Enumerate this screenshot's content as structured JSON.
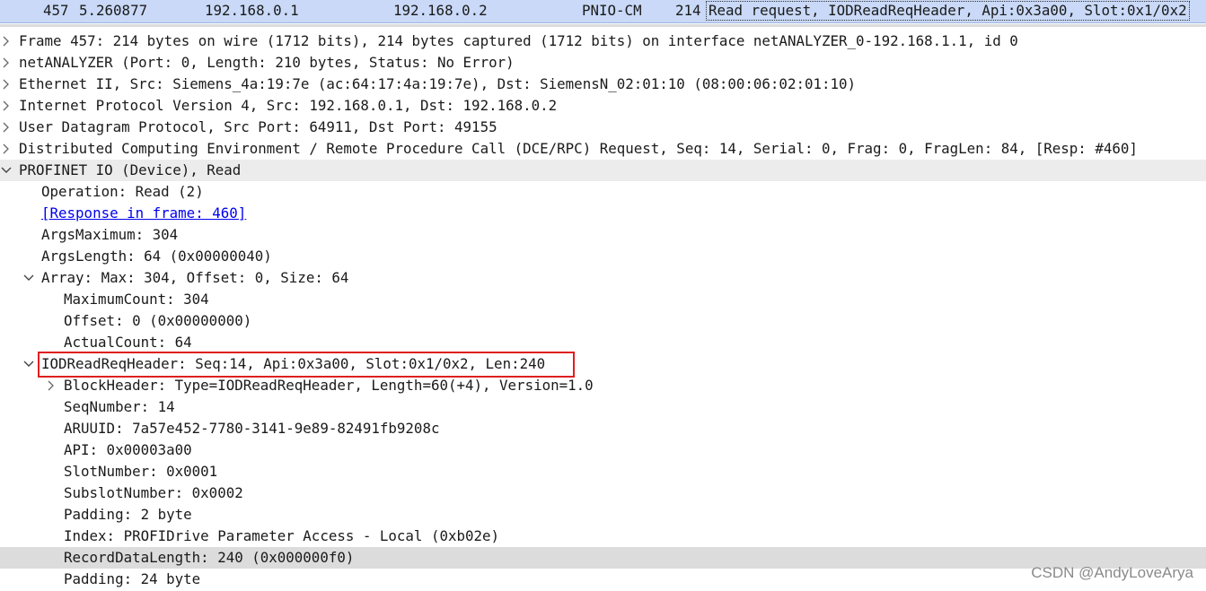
{
  "packet_list_row": {
    "number": "457",
    "time": "5.260877",
    "source": "192.168.0.1",
    "destination": "192.168.0.2",
    "protocol": "PNIO-CM",
    "length": "214",
    "info": "Read request, IODReadReqHeader, Api:0x3a00, Slot:0x1/0x2"
  },
  "detail_tree": [
    {
      "level": 0,
      "toggle": "collapsed",
      "text": "Frame 457: 214 bytes on wire (1712 bits), 214 bytes captured (1712 bits) on interface netANALYZER_0-192.168.1.1, id 0",
      "name": "tree-row-frame",
      "shaded": false
    },
    {
      "level": 0,
      "toggle": "collapsed",
      "text": "netANALYZER (Port: 0, Length: 210 bytes, Status: No Error)",
      "name": "tree-row-netanalyzer",
      "shaded": false
    },
    {
      "level": 0,
      "toggle": "collapsed",
      "text": "Ethernet II, Src: Siemens_4a:19:7e (ac:64:17:4a:19:7e), Dst: SiemensN_02:01:10 (08:00:06:02:01:10)",
      "name": "tree-row-ethernet",
      "shaded": false
    },
    {
      "level": 0,
      "toggle": "collapsed",
      "text": "Internet Protocol Version 4, Src: 192.168.0.1, Dst: 192.168.0.2",
      "name": "tree-row-ipv4",
      "shaded": false
    },
    {
      "level": 0,
      "toggle": "collapsed",
      "text": "User Datagram Protocol, Src Port: 64911, Dst Port: 49155",
      "name": "tree-row-udp",
      "shaded": false
    },
    {
      "level": 0,
      "toggle": "collapsed",
      "text": "Distributed Computing Environment / Remote Procedure Call (DCE/RPC) Request, Seq: 14, Serial: 0, Frag: 0, FragLen: 84, [Resp: #460]",
      "name": "tree-row-dcerpc",
      "shaded": false
    },
    {
      "level": 0,
      "toggle": "expanded",
      "text": "PROFINET IO (Device), Read",
      "name": "tree-row-profinet-io",
      "shaded": true
    },
    {
      "level": 1,
      "toggle": "none",
      "text": "Operation: Read (2)",
      "name": "tree-row-operation",
      "shaded": false
    },
    {
      "level": 1,
      "toggle": "none",
      "text": "[Response in frame: 460]",
      "name": "tree-row-response-link",
      "shaded": false,
      "link": true
    },
    {
      "level": 1,
      "toggle": "none",
      "text": "ArgsMaximum: 304",
      "name": "tree-row-args-maximum",
      "shaded": false
    },
    {
      "level": 1,
      "toggle": "none",
      "text": "ArgsLength: 64 (0x00000040)",
      "name": "tree-row-args-length",
      "shaded": false
    },
    {
      "level": 1,
      "toggle": "expanded",
      "text": "Array: Max: 304, Offset: 0, Size: 64",
      "name": "tree-row-array",
      "shaded": false
    },
    {
      "level": 2,
      "toggle": "none",
      "text": "MaximumCount: 304",
      "name": "tree-row-maximum-count",
      "shaded": false
    },
    {
      "level": 2,
      "toggle": "none",
      "text": "Offset: 0 (0x00000000)",
      "name": "tree-row-offset",
      "shaded": false
    },
    {
      "level": 2,
      "toggle": "none",
      "text": "ActualCount: 64",
      "name": "tree-row-actual-count",
      "shaded": false
    },
    {
      "level": 1,
      "toggle": "expanded",
      "text": "IODReadReqHeader: Seq:14, Api:0x3a00, Slot:0x1/0x2, Len:240",
      "name": "tree-row-iod-read-req-header",
      "shaded": false,
      "boxed": true
    },
    {
      "level": 2,
      "toggle": "collapsed",
      "text": "BlockHeader: Type=IODReadReqHeader, Length=60(+4), Version=1.0",
      "name": "tree-row-block-header",
      "shaded": false
    },
    {
      "level": 2,
      "toggle": "none",
      "text": "SeqNumber: 14",
      "name": "tree-row-seq-number",
      "shaded": false
    },
    {
      "level": 2,
      "toggle": "none",
      "text": "ARUUID: 7a57e452-7780-3141-9e89-82491fb9208c",
      "name": "tree-row-aruuid",
      "shaded": false
    },
    {
      "level": 2,
      "toggle": "none",
      "text": "API: 0x00003a00",
      "name": "tree-row-api",
      "shaded": false
    },
    {
      "level": 2,
      "toggle": "none",
      "text": "SlotNumber: 0x0001",
      "name": "tree-row-slot-number",
      "shaded": false
    },
    {
      "level": 2,
      "toggle": "none",
      "text": "SubslotNumber: 0x0002",
      "name": "tree-row-subslot-number",
      "shaded": false
    },
    {
      "level": 2,
      "toggle": "none",
      "text": "Padding: 2 byte",
      "name": "tree-row-padding-2",
      "shaded": false
    },
    {
      "level": 2,
      "toggle": "none",
      "text": "Index: PROFIDrive Parameter Access - Local (0xb02e)",
      "name": "tree-row-index",
      "shaded": false
    },
    {
      "level": 2,
      "toggle": "none",
      "text": "RecordDataLength: 240 (0x000000f0)",
      "name": "tree-row-record-data-length",
      "shaded": false,
      "selected": true
    },
    {
      "level": 2,
      "toggle": "none",
      "text": "Padding: 24 byte",
      "name": "tree-row-padding-24",
      "shaded": false
    }
  ],
  "watermark": "CSDN @AndyLoveArya",
  "colors": {
    "packet_row_bg": "#c9d9f7",
    "highlight_box": "#e01f1f",
    "link": "#0000ee",
    "selected_row_bg": "#dcdcdc"
  },
  "icons": {
    "collapsed": "chevron-right-icon",
    "expanded": "chevron-down-icon"
  }
}
